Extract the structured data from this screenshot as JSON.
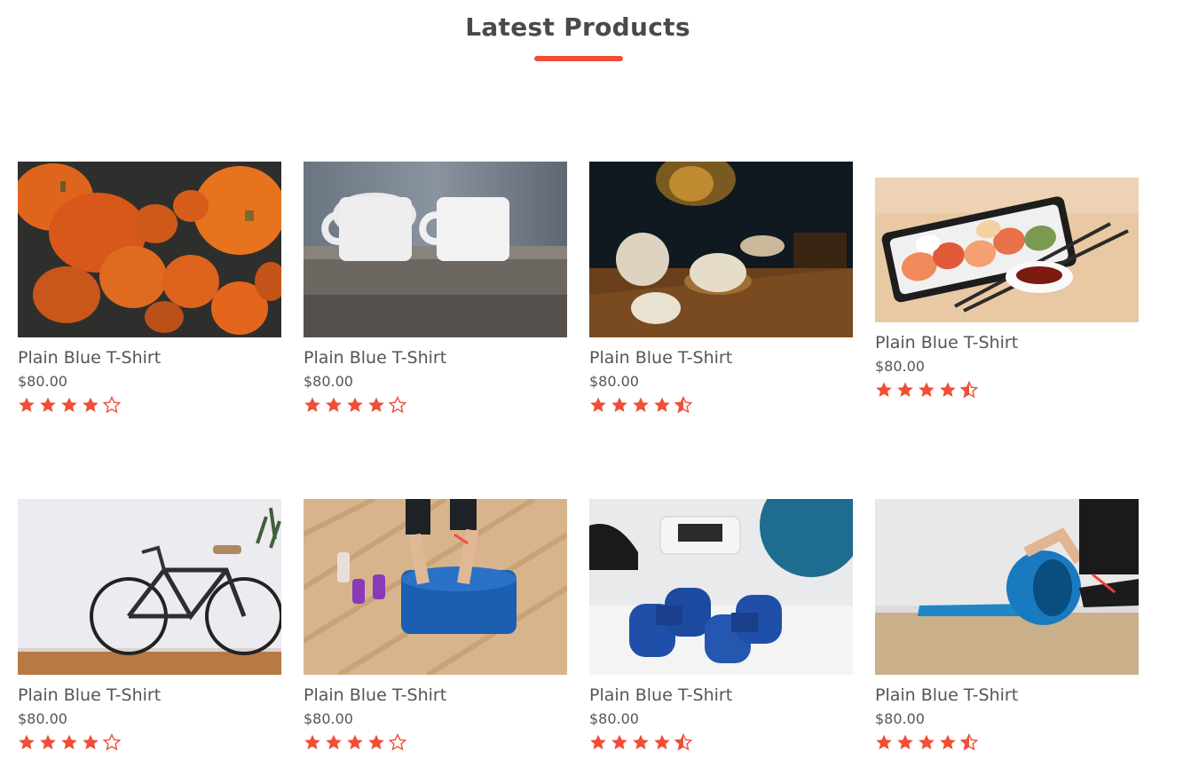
{
  "section": {
    "title": "Latest Products",
    "accent_color": "#f04e36"
  },
  "products": [
    {
      "name": "Plain Blue T-Shirt",
      "price": "$80.00",
      "rating": 4,
      "image": "pumpkins-photo"
    },
    {
      "name": "Plain Blue T-Shirt",
      "price": "$80.00",
      "rating": 4,
      "image": "white-mugs-photo"
    },
    {
      "name": "Plain Blue T-Shirt",
      "price": "$80.00",
      "rating": 4.5,
      "image": "tea-set-photo"
    },
    {
      "name": "Plain Blue T-Shirt",
      "price": "$80.00",
      "rating": 4.5,
      "image": "sushi-tray-photo"
    },
    {
      "name": "Plain Blue T-Shirt",
      "price": "$80.00",
      "rating": 4,
      "image": "bicycle-photo"
    },
    {
      "name": "Plain Blue T-Shirt",
      "price": "$80.00",
      "rating": 4,
      "image": "yoga-mat-dumbbells-photo"
    },
    {
      "name": "Plain Blue T-Shirt",
      "price": "$80.00",
      "rating": 4.5,
      "image": "blue-dumbbells-photo"
    },
    {
      "name": "Plain Blue T-Shirt",
      "price": "$80.00",
      "rating": 4.5,
      "image": "rolling-yoga-mat-photo"
    }
  ]
}
